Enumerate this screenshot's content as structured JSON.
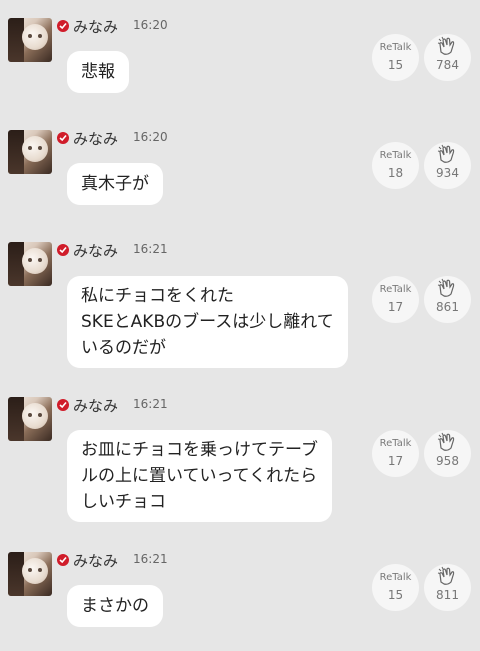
{
  "messages": [
    {
      "user": "みなみ",
      "time": "16:20",
      "lines": [
        "悲報"
      ],
      "retalk_label": "ReTalk",
      "retalk_count": "15",
      "clap_count": "784"
    },
    {
      "user": "みなみ",
      "time": "16:20",
      "lines": [
        "真木子が"
      ],
      "retalk_label": "ReTalk",
      "retalk_count": "18",
      "clap_count": "934"
    },
    {
      "user": "みなみ",
      "time": "16:21",
      "lines": [
        "私にチョコをくれた",
        "SKEとAKBのブースは少し離れて",
        "いるのだが"
      ],
      "retalk_label": "ReTalk",
      "retalk_count": "17",
      "clap_count": "861"
    },
    {
      "user": "みなみ",
      "time": "16:21",
      "lines": [
        "お皿にチョコを乗っけてテーブ",
        "ルの上に置いていってくれたら",
        "しいチョコ"
      ],
      "retalk_label": "ReTalk",
      "retalk_count": "17",
      "clap_count": "958"
    },
    {
      "user": "みなみ",
      "time": "16:21",
      "lines": [
        "まさかの"
      ],
      "retalk_label": "ReTalk",
      "retalk_count": "15",
      "clap_count": "811"
    }
  ],
  "colors": {
    "background": "#e6e6e6",
    "verified": "#d01c2a",
    "bubble": "#ffffff"
  },
  "icons": {
    "verified": "check-badge-icon",
    "clap": "clapping-hands-icon"
  }
}
